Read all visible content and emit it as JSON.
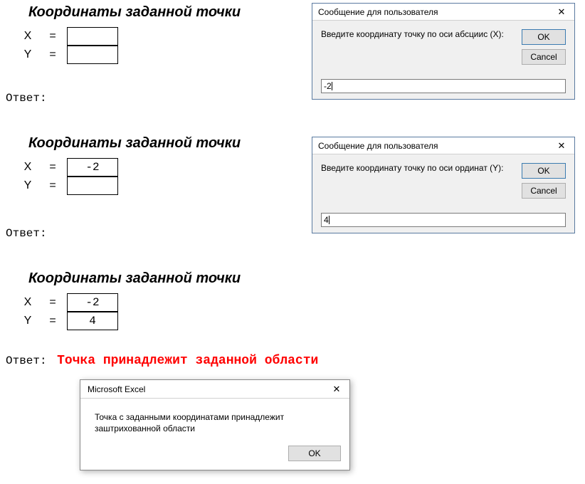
{
  "section1": {
    "heading": "Координаты заданной точки",
    "labels": {
      "x": "X",
      "y": "Y",
      "eq": "="
    },
    "values": {
      "x": "",
      "y": ""
    },
    "answer_label": "Ответ:",
    "answer_text": ""
  },
  "section2": {
    "heading": "Координаты заданной точки",
    "labels": {
      "x": "X",
      "y": "Y",
      "eq": "="
    },
    "values": {
      "x": "-2",
      "y": ""
    },
    "answer_label": "Ответ:",
    "answer_text": ""
  },
  "section3": {
    "heading": "Координаты заданной точки",
    "labels": {
      "x": "X",
      "y": "Y",
      "eq": "="
    },
    "values": {
      "x": "-2",
      "y": "4"
    },
    "answer_label": "Ответ:",
    "answer_text": "Точка принадлежит заданной области"
  },
  "dialog1": {
    "title": "Сообщение для пользователя",
    "prompt": "Введите координату точку по оси абсциис (Х):",
    "ok": "OK",
    "cancel": "Cancel",
    "input_value": "-2"
  },
  "dialog2": {
    "title": "Сообщение для пользователя",
    "prompt": "Введите координату точку по оси ординат (Y):",
    "ok": "OK",
    "cancel": "Cancel",
    "input_value": "4"
  },
  "msgbox": {
    "title": "Microsoft Excel",
    "text": "Точка с заданными координатами принадлежит заштрихованной области",
    "ok": "OK"
  }
}
